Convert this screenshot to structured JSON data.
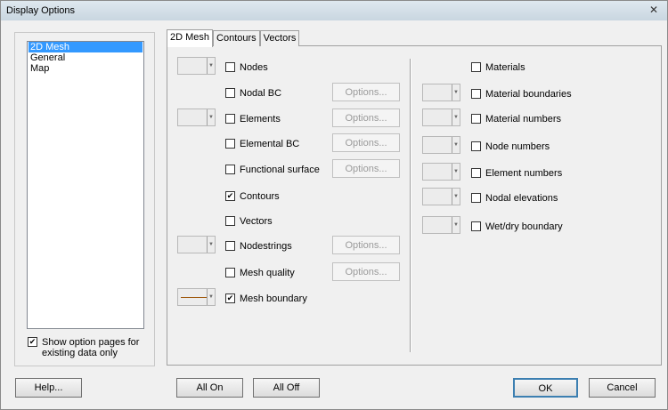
{
  "window": {
    "title": "Display Options",
    "close_icon": "close-icon"
  },
  "sidebar": {
    "items": [
      "2D Mesh",
      "General",
      "Map"
    ],
    "selected": "2D Mesh",
    "show_option_pages_label_1": "Show option pages for",
    "show_option_pages_label_2": "existing data only",
    "show_option_pages_checked": true
  },
  "tabs": [
    "2D Mesh",
    "Contours",
    "Vectors"
  ],
  "active_tab": "2D Mesh",
  "options_label": "Options...",
  "left_items": [
    {
      "label": "Nodes",
      "checked": false
    },
    {
      "label": "Nodal BC",
      "checked": false
    },
    {
      "label": "Elements",
      "checked": false
    },
    {
      "label": "Elemental BC",
      "checked": false
    },
    {
      "label": "Functional surface",
      "checked": false
    },
    {
      "label": "Contours",
      "checked": true
    },
    {
      "label": "Vectors",
      "checked": false
    },
    {
      "label": "Nodestrings",
      "checked": false
    },
    {
      "label": "Mesh quality",
      "checked": false
    },
    {
      "label": "Mesh boundary",
      "checked": true
    }
  ],
  "right_items": [
    {
      "label": "Materials",
      "checked": false
    },
    {
      "label": "Material boundaries",
      "checked": false
    },
    {
      "label": "Material numbers",
      "checked": false
    },
    {
      "label": "Node numbers",
      "checked": false
    },
    {
      "label": "Element numbers",
      "checked": false
    },
    {
      "label": "Nodal elevations",
      "checked": false
    },
    {
      "label": "Wet/dry boundary",
      "checked": false
    }
  ],
  "mesh_boundary_color": "#a05a10",
  "buttons": {
    "help": "Help...",
    "all_on": "All On",
    "all_off": "All Off",
    "ok": "OK",
    "cancel": "Cancel"
  }
}
